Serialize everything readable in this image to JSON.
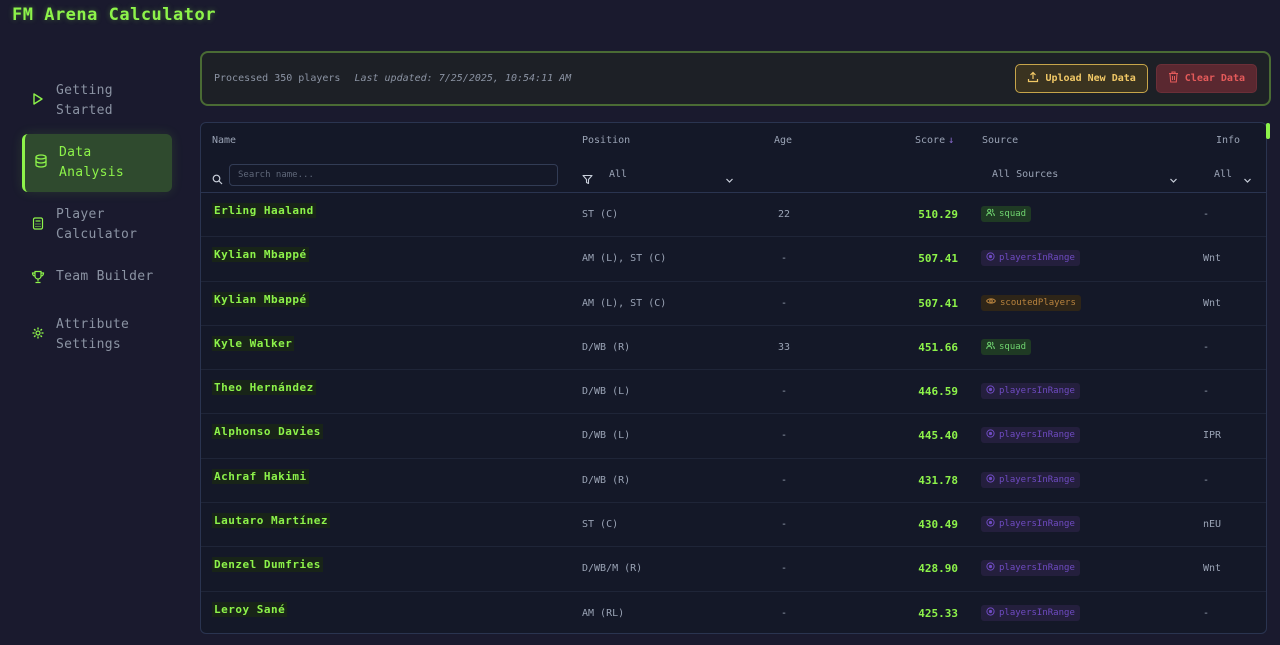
{
  "app": {
    "title": "FM Arena Calculator"
  },
  "sidebar": {
    "items": [
      {
        "label": "Getting Started",
        "icon": "play-icon",
        "active": false
      },
      {
        "label": "Data Analysis",
        "icon": "database-icon",
        "active": true
      },
      {
        "label": "Player Calculator",
        "icon": "calculator-icon",
        "active": false
      },
      {
        "label": "Team Builder",
        "icon": "trophy-icon",
        "active": false
      },
      {
        "label": "Attribute Settings",
        "icon": "gear-icon",
        "active": false
      }
    ]
  },
  "status": {
    "processed": "Processed 350 players",
    "updated": "Last updated: 7/25/2025, 10:54:11 AM",
    "upload_label": "Upload New Data",
    "clear_label": "Clear Data"
  },
  "table": {
    "headers": {
      "name": "Name",
      "position": "Position",
      "age": "Age",
      "score": "Score",
      "score_sort": "↓",
      "source": "Source",
      "info": "Info"
    },
    "filters": {
      "search_placeholder": "Search name...",
      "position_value": "All",
      "source_value": "All Sources",
      "info_value": "All"
    },
    "rows": [
      {
        "name": "Erling Haaland",
        "position": "ST (C)",
        "age": "22",
        "score": "510.29",
        "source": "squad",
        "source_type": "squad",
        "info": "-"
      },
      {
        "name": "Kylian Mbappé",
        "position": "AM (L), ST (C)",
        "age": "-",
        "score": "507.41",
        "source": "playersInRange",
        "source_type": "range",
        "info": "Wnt"
      },
      {
        "name": "Kylian Mbappé",
        "position": "AM (L), ST (C)",
        "age": "-",
        "score": "507.41",
        "source": "scoutedPlayers",
        "source_type": "scouted",
        "info": "Wnt"
      },
      {
        "name": "Kyle Walker",
        "position": "D/WB (R)",
        "age": "33",
        "score": "451.66",
        "source": "squad",
        "source_type": "squad",
        "info": "-"
      },
      {
        "name": "Theo Hernández",
        "position": "D/WB (L)",
        "age": "-",
        "score": "446.59",
        "source": "playersInRange",
        "source_type": "range",
        "info": "-"
      },
      {
        "name": "Alphonso Davies",
        "position": "D/WB (L)",
        "age": "-",
        "score": "445.40",
        "source": "playersInRange",
        "source_type": "range",
        "info": "IPR"
      },
      {
        "name": "Achraf Hakimi",
        "position": "D/WB (R)",
        "age": "-",
        "score": "431.78",
        "source": "playersInRange",
        "source_type": "range",
        "info": "-"
      },
      {
        "name": "Lautaro Martínez",
        "position": "ST (C)",
        "age": "-",
        "score": "430.49",
        "source": "playersInRange",
        "source_type": "range",
        "info": "nEU"
      },
      {
        "name": "Denzel Dumfries",
        "position": "D/WB/M (R)",
        "age": "-",
        "score": "428.90",
        "source": "playersInRange",
        "source_type": "range",
        "info": "Wnt"
      },
      {
        "name": "Leroy Sané",
        "position": "AM (RL)",
        "age": "-",
        "score": "425.33",
        "source": "playersInRange",
        "source_type": "range",
        "info": "-"
      }
    ]
  },
  "colors": {
    "accent": "#8df34a",
    "background": "#1a1a2e",
    "upload": "#f1c866",
    "danger": "#e45a5a"
  }
}
